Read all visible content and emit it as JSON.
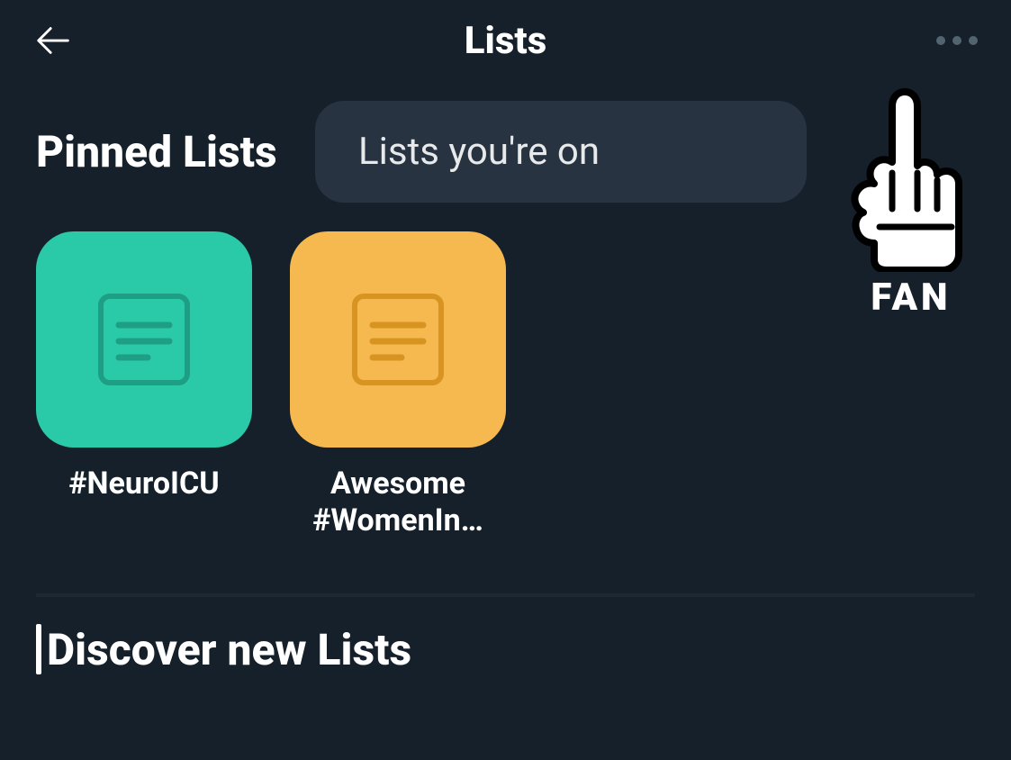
{
  "header": {
    "title": "Lists"
  },
  "sections": {
    "pinned_title": "Pinned Lists",
    "discover_title": "Discover new Lists"
  },
  "popup": {
    "label": "Lists you're on"
  },
  "pinned": [
    {
      "label": "#NeuroICU",
      "color": "teal"
    },
    {
      "label": "Awesome #WomenIn…",
      "color": "orange"
    }
  ],
  "badge": {
    "label": "FAN"
  }
}
